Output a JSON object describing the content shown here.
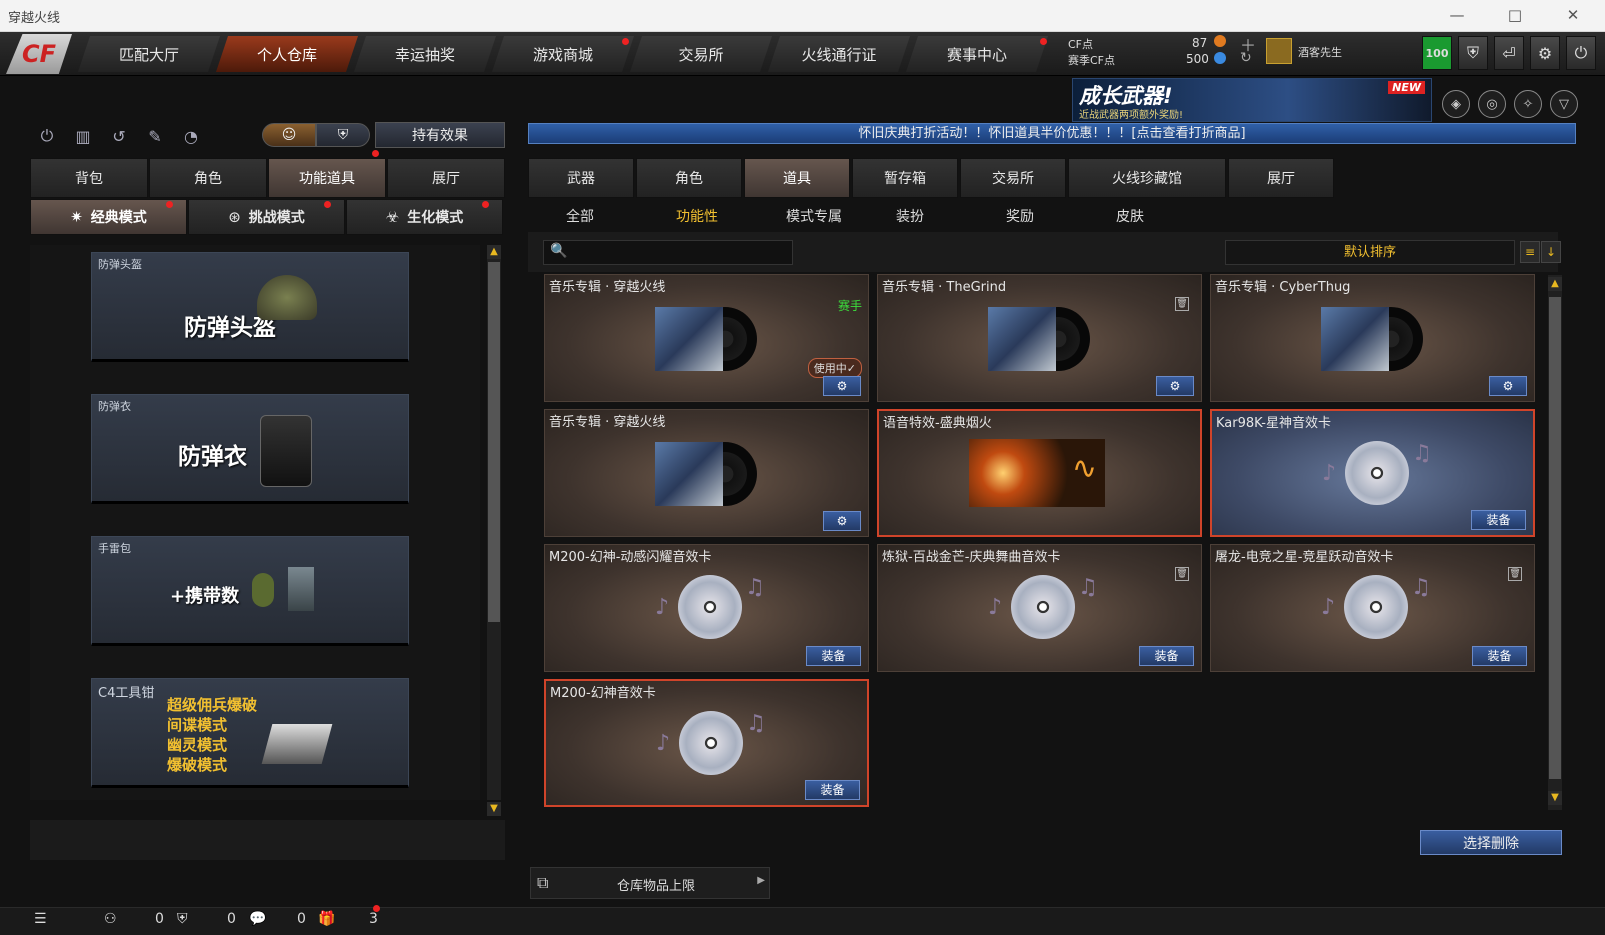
{
  "window": {
    "title": "穿越火线",
    "controls": [
      "—",
      "□",
      "✕"
    ]
  },
  "logo": "CF",
  "topnav": {
    "tabs": [
      "匹配大厅",
      "个人仓库",
      "幸运抽奖",
      "游戏商城",
      "交易所",
      "火线通行证",
      "赛事中心"
    ],
    "active": 1
  },
  "currency": {
    "cf_label": "CF点",
    "cf_value": "87",
    "match_label": "赛季CF点",
    "match_value": "500",
    "user": "酒客先生",
    "level": "100"
  },
  "banner": {
    "title": "成长武器!",
    "subtitle": "近战武器两项额外奖励!",
    "badge": "NEW"
  },
  "left": {
    "hold_effect": "持有效果",
    "tabs": [
      "背包",
      "角色",
      "功能道具",
      "展厅"
    ],
    "active_tab": 2,
    "modes": [
      "经典模式",
      "挑战模式",
      "生化模式"
    ],
    "cards": [
      {
        "name": "防弹头盔",
        "big": "防弹头盔"
      },
      {
        "name": "防弹衣",
        "big": "防弹衣"
      },
      {
        "name": "手雷包",
        "big": "+携带数"
      },
      {
        "name": "C4工具钳",
        "lines": [
          "超级佣兵爆破",
          "间谍模式",
          "幽灵模式",
          "爆破模式"
        ]
      }
    ]
  },
  "right": {
    "alert": "怀旧庆典打折活动！！怀旧道具半价优惠！！！[点击查看打折商品]",
    "tabs": [
      "武器",
      "角色",
      "道具",
      "暂存箱",
      "交易所",
      "火线珍藏馆",
      "展厅"
    ],
    "active_tab": 2,
    "subtabs": [
      "全部",
      "功能性",
      "模式专属",
      "装扮",
      "奖励",
      "皮肤"
    ],
    "active_sub": 1,
    "search_placeholder": "",
    "sort": "默认排序",
    "items": [
      {
        "name": "音乐专辑 · 穿越火线",
        "tag": "赛手",
        "badge": "使用中✓",
        "action": "⚙",
        "kind": "album"
      },
      {
        "name": "音乐专辑 · TheGrind",
        "action": "⚙",
        "kind": "album",
        "del": "🗑"
      },
      {
        "name": "音乐专辑 · CyberThug",
        "action": "⚙",
        "kind": "album"
      },
      {
        "name": "音乐专辑 · 穿越火线",
        "action": "⚙",
        "kind": "album"
      },
      {
        "name": "语音特效-盛典烟火",
        "kind": "fx",
        "selected": true
      },
      {
        "name": "Kar98K-星神音效卡",
        "action": "装备",
        "kind": "cd",
        "selected": true,
        "blue": true
      },
      {
        "name": "M200-幻神-动感闪耀音效卡",
        "action": "装备",
        "kind": "cd"
      },
      {
        "name": "炼狱-百战金芒-庆典舞曲音效卡",
        "action": "装备",
        "kind": "cd",
        "del": "🗑"
      },
      {
        "name": "屠龙-电竞之星-竞星跃动音效卡",
        "action": "装备",
        "kind": "cd",
        "del": "🗑"
      },
      {
        "name": "M200-幻神音效卡",
        "action": "装备",
        "kind": "cd",
        "selected": true
      }
    ],
    "delete_btn": "选择删除",
    "capacity": "仓库物品上限"
  },
  "bottom": {
    "a": "0",
    "b": "0",
    "c": "0",
    "d": "3"
  }
}
